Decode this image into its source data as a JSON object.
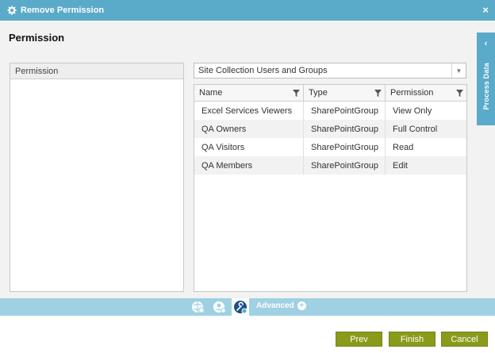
{
  "window": {
    "title": "Remove Permission",
    "close_glyph": "×"
  },
  "page": {
    "title": "Permission"
  },
  "left_panel": {
    "header": "Permission"
  },
  "dropdown": {
    "selected": "Site Collection Users and Groups"
  },
  "grid": {
    "columns": [
      "Name",
      "Type",
      "Permission"
    ],
    "rows": [
      {
        "name": "Excel Services Viewers",
        "type": "SharePointGroup",
        "permission": "View Only"
      },
      {
        "name": "QA Owners",
        "type": "SharePointGroup",
        "permission": "Full Control"
      },
      {
        "name": "QA Visitors",
        "type": "SharePointGroup",
        "permission": "Read"
      },
      {
        "name": "QA Members",
        "type": "SharePointGroup",
        "permission": "Edit"
      }
    ]
  },
  "side_tab": {
    "label": "Process Data",
    "chevron": "‹"
  },
  "toolbar": {
    "icons": [
      "globe-gear-icon",
      "user-settings-icon",
      "wrench-icon"
    ],
    "advanced_label": "Advanced",
    "advanced_plus": "+"
  },
  "footer": {
    "prev_label": "Prev",
    "finish_label": "Finish",
    "cancel_label": "Cancel"
  },
  "colors": {
    "header": "#5aaac9",
    "toolbar": "#9fd1e2",
    "button": "#8a9a1b"
  }
}
